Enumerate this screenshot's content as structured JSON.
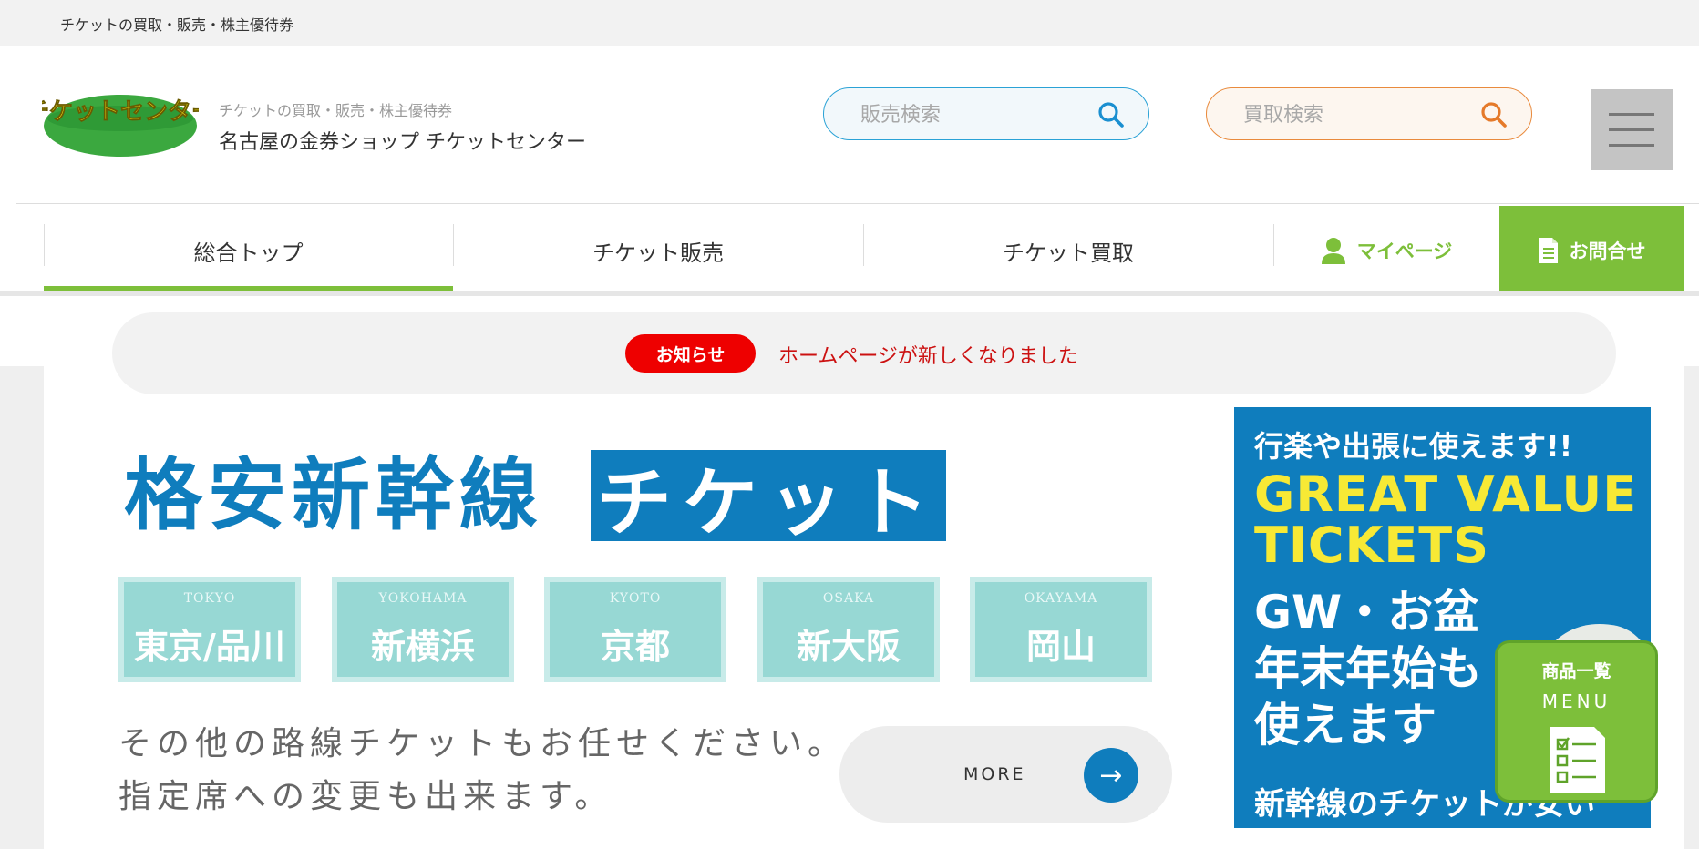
{
  "topbar": {
    "text": "チケットの買取・販売・株主優待券"
  },
  "brand": {
    "logo_text": "チケットセンター",
    "sub": "チケットの買取・販売・株主優待券",
    "title": "名古屋の金券ショップ チケットセンター"
  },
  "search": {
    "sell_placeholder": "販売検索",
    "buy_placeholder": "買取検索"
  },
  "nav": {
    "items": [
      {
        "label": "総合トップ",
        "active": true
      },
      {
        "label": "チケット販売",
        "active": false
      },
      {
        "label": "チケット買取",
        "active": false
      }
    ],
    "mypage": "マイページ",
    "contact": "お問合せ"
  },
  "notice": {
    "badge": "お知らせ",
    "text": "ホームページが新しくなりました"
  },
  "hero": {
    "title": "格安新幹線",
    "title_box": "チケット",
    "cities": [
      {
        "en": "TOKYO",
        "ja": "東京/品川"
      },
      {
        "en": "YOKOHAMA",
        "ja": "新横浜"
      },
      {
        "en": "KYOTO",
        "ja": "京都"
      },
      {
        "en": "OSAKA",
        "ja": "新大阪"
      },
      {
        "en": "OKAYAMA",
        "ja": "岡山"
      }
    ],
    "desc1": "その他の路線チケットもお任せください。",
    "desc2": "指定席への変更も出来ます。",
    "more": "MORE",
    "more_arrow": "→"
  },
  "promo": {
    "line1": "行楽や出張に使えます!!",
    "line2a": "GREAT VALUE",
    "line2b": "TICKETS",
    "line3a": "GW・お盆",
    "line3b": "年末年始も",
    "line3c": "使えます",
    "line4": "新幹線のチケットが安い"
  },
  "float_menu": {
    "title": "商品一覧",
    "sub": "MENU"
  },
  "colors": {
    "green": "#7dbf3a",
    "blue": "#0f7dbd",
    "red": "#ee0000",
    "sell_border": "#2aa2d6",
    "buy_border": "#e98a3c"
  }
}
